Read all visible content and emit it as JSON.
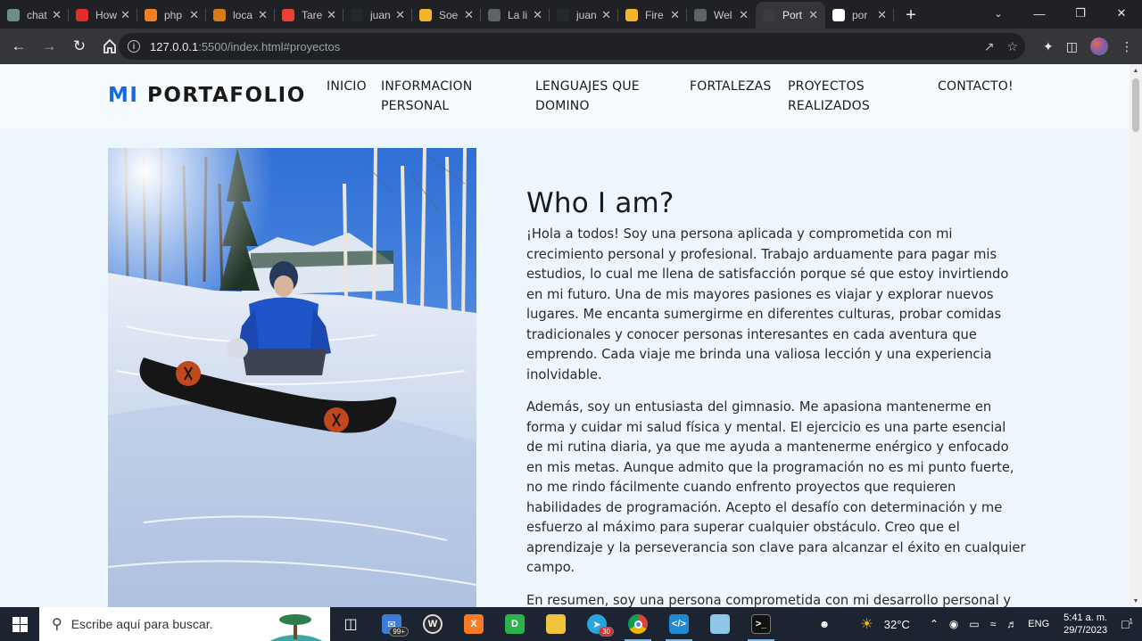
{
  "browser": {
    "tabs": [
      {
        "title": "chat",
        "icon": "chatgpt-icon",
        "color": "#6b8f84"
      },
      {
        "title": "How",
        "icon": "youtube-icon",
        "color": "#e52d27"
      },
      {
        "title": "php",
        "icon": "stackoverflow-icon",
        "color": "#f48024"
      },
      {
        "title": "loca",
        "icon": "xampp-icon",
        "color": "#d97a1a"
      },
      {
        "title": "Tare",
        "icon": "gmail-icon",
        "color": "#ea4335"
      },
      {
        "title": "juan",
        "icon": "github-icon",
        "color": "#24292e"
      },
      {
        "title": "Soe",
        "icon": "hand-icon",
        "color": "#f2b52c"
      },
      {
        "title": "La li",
        "icon": "globe-icon",
        "color": "#5f6368"
      },
      {
        "title": "juan",
        "icon": "github-icon",
        "color": "#24292e"
      },
      {
        "title": "Fire",
        "icon": "hand-icon",
        "color": "#f2b52c"
      },
      {
        "title": "Wel",
        "icon": "globe-icon",
        "color": "#5f6368"
      },
      {
        "title": "Port",
        "icon": "folder-icon",
        "color": "#3c3c3c",
        "active": true
      },
      {
        "title": "por",
        "icon": "google-icon",
        "color": "#ffffff"
      }
    ],
    "url_host": "127.0.0.1",
    "url_rest": ":5500/index.html#proyectos"
  },
  "site": {
    "logo_mi": "MI",
    "logo_rest": " PORTAFOLIO",
    "nav": {
      "inicio": "INICIO",
      "informacion_1": "INFORMACION",
      "informacion_2": "PERSONAL",
      "lenguajes_1": "LENGUAJES QUE",
      "lenguajes_2": "DOMINO",
      "fortalezas": "FORTALEZAS",
      "proyectos_1": "PROYECTOS",
      "proyectos_2": "REALIZADOS",
      "contacto": "CONTACTO!"
    },
    "about": {
      "title": "Who I am?",
      "p1": "¡Hola a todos! Soy una persona aplicada y comprometida con mi crecimiento personal y profesional. Trabajo arduamente para pagar mis estudios, lo cual me llena de satisfacción porque sé que estoy invirtiendo en mi futuro. Una de mis mayores pasiones es viajar y explorar nuevos lugares. Me encanta sumergirme en diferentes culturas, probar comidas tradicionales y conocer personas interesantes en cada aventura que emprendo. Cada viaje me brinda una valiosa lección y una experiencia inolvidable.",
      "p2": "Además, soy un entusiasta del gimnasio. Me apasiona mantenerme en forma y cuidar mi salud física y mental. El ejercicio es una parte esencial de mi rutina diaria, ya que me ayuda a mantenerme enérgico y enfocado en mis metas. Aunque admito que la programación no es mi punto fuerte, no me rindo fácilmente cuando enfrento proyectos que requieren habilidades de programación. Acepto el desafío con determinación y me esfuerzo al máximo para superar cualquier obstáculo. Creo que el aprendizaje y la perseverancia son clave para alcanzar el éxito en cualquier campo.",
      "p3": "En resumen, soy una persona comprometida con mi desarrollo personal y"
    }
  },
  "taskbar": {
    "search_placeholder": "Escribe aquí para buscar.",
    "mail_badge": "99+",
    "telegram_badge": "30",
    "temperature": "32°C",
    "language": "ENG",
    "time": "5:41 a. m.",
    "date": "29/7/2023",
    "notifications": "1"
  }
}
